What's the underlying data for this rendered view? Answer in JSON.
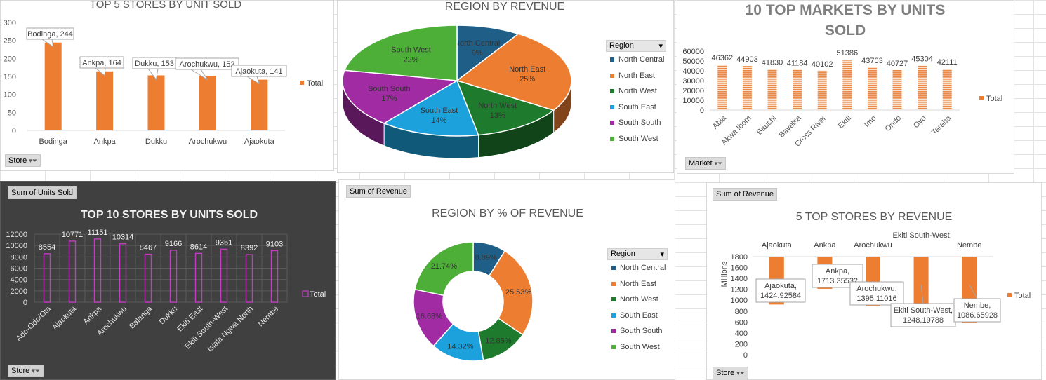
{
  "charts": {
    "c1": {
      "type": "bar",
      "title": "TOP 5 STORES BY UNIT SOLD",
      "color": "#ed7d31",
      "categories": [
        "Bodinga",
        "Ankpa",
        "Dukku",
        "Arochukwu",
        "Ajaokuta"
      ],
      "values": [
        244,
        164,
        153,
        152,
        141
      ],
      "labels": [
        "Bodinga, 244",
        "Ankpa, 164",
        "Dukku, 153",
        "Arochukwu, 152",
        "Ajaokuta, 141"
      ],
      "yticks": [
        "0",
        "50",
        "100",
        "150",
        "200",
        "250",
        "300"
      ],
      "ylim": [
        0,
        300
      ],
      "legend": "Total",
      "filter": "Store"
    },
    "c2": {
      "type": "pie",
      "title": "REGION BY REVENUE",
      "filter_label": "Region",
      "slices": [
        {
          "name": "North Central",
          "pct": "9%",
          "value": 9,
          "color": "#1f5f87"
        },
        {
          "name": "North East",
          "pct": "25%",
          "value": 25,
          "color": "#ed7d31"
        },
        {
          "name": "North West",
          "pct": "13%",
          "value": 13,
          "color": "#1e7b2e"
        },
        {
          "name": "South East",
          "pct": "14%",
          "value": 14,
          "color": "#1da1dc"
        },
        {
          "name": "South South",
          "pct": "17%",
          "value": 17,
          "color": "#a02ba3"
        },
        {
          "name": "South West",
          "pct": "22%",
          "value": 22,
          "color": "#4eaf38"
        }
      ]
    },
    "c3": {
      "type": "bar",
      "title_line1": "10 TOP MARKETS BY UNITS",
      "title_line2": "SOLD",
      "color": "#f0a470",
      "categories": [
        "Abia",
        "Akwa Ibom",
        "Bauchi",
        "Bayelsa",
        "Cross River",
        "Ekiti",
        "Imo",
        "Ondo",
        "Oyo",
        "Taraba"
      ],
      "values": [
        46362,
        44903,
        41830,
        41184,
        40102,
        51386,
        43703,
        40727,
        45304,
        42111
      ],
      "labels": [
        "46362",
        "44903",
        "41830",
        "41184",
        "40102",
        "51386",
        "43703",
        "40727",
        "45304",
        "42111"
      ],
      "yticks": [
        "0",
        "10000",
        "20000",
        "30000",
        "40000",
        "50000",
        "60000"
      ],
      "ylim": [
        0,
        60000
      ],
      "legend": "Total",
      "filter": "Market"
    },
    "c4": {
      "type": "bar",
      "title": "TOP 10 STORES BY UNITS SOLD",
      "color": "#c23cc0",
      "button": "Sum of Units Sold",
      "categories": [
        "Ado-Odo/Ota",
        "Ajaokuta",
        "Ankpa",
        "Arochukwu",
        "Balanga",
        "Dukku",
        "Ekiti East",
        "Ekiti South-West",
        "Isiala Ngwa North",
        "Nembe"
      ],
      "values": [
        8554,
        10771,
        11151,
        10314,
        8467,
        9166,
        8614,
        9351,
        8392,
        9103
      ],
      "labels": [
        "8554",
        "10771",
        "11151",
        "10314",
        "8467",
        "9166",
        "8614",
        "9351",
        "8392",
        "9103"
      ],
      "yticks": [
        "0",
        "2000",
        "4000",
        "6000",
        "8000",
        "10000",
        "12000"
      ],
      "ylim": [
        0,
        12000
      ],
      "legend": "Total",
      "filter": "Store"
    },
    "c5": {
      "type": "pie",
      "title": "REGION BY % OF REVENUE",
      "button": "Sum of Revenue",
      "filter_label": "Region",
      "slices": [
        {
          "name": "North Central",
          "pct": "8.89%",
          "value": 8.89,
          "color": "#1f5f87"
        },
        {
          "name": "North East",
          "pct": "25.53%",
          "value": 25.53,
          "color": "#ed7d31"
        },
        {
          "name": "North West",
          "pct": "12.85%",
          "value": 12.85,
          "color": "#1e7b2e"
        },
        {
          "name": "South East",
          "pct": "14.32%",
          "value": 14.32,
          "color": "#1da1dc"
        },
        {
          "name": "South South",
          "pct": "16.68%",
          "value": 16.68,
          "color": "#a02ba3"
        },
        {
          "name": "South West",
          "pct": "21.74%",
          "value": 21.74,
          "color": "#4eaf38"
        }
      ]
    },
    "c6": {
      "type": "bar",
      "title": "5 TOP STORES BY REVENUE",
      "color": "#ed7d31",
      "button": "Sum of Revenue",
      "ylabel": "Millions",
      "categories": [
        "Ajaokuta",
        "Ankpa",
        "Arochukwu",
        "Ekiti South-West",
        "Nembe"
      ],
      "values": [
        1424.92584,
        1713.35532,
        1395.11016,
        1248.19788,
        1086.65928
      ],
      "label_line1": [
        "Ajaokuta,",
        "Ankpa,",
        "Arochukwu,",
        "Ekiti South-West,",
        "Nembe,"
      ],
      "label_line2": [
        "1424.92584",
        "1713.35532",
        "1395.11016",
        "1248.19788",
        "1086.65928"
      ],
      "yticks": [
        "0",
        "200",
        "400",
        "600",
        "800",
        "1000",
        "1200",
        "1400",
        "1600",
        "1800"
      ],
      "ylim": [
        0,
        1800
      ],
      "legend": "Total",
      "filter": "Store"
    }
  }
}
